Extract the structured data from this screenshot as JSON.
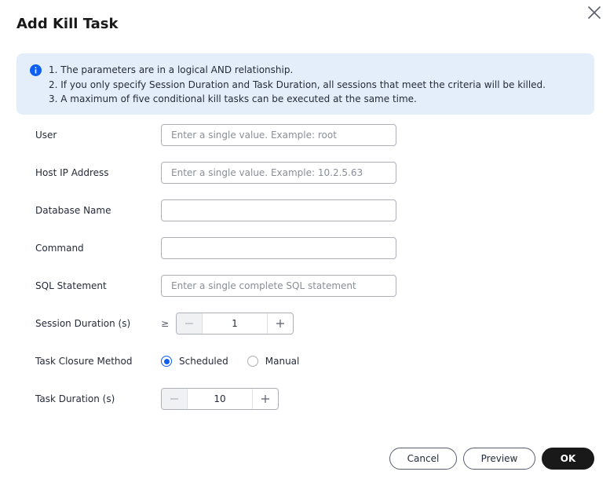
{
  "dialog": {
    "title": "Add Kill Task",
    "close_icon": "close-icon"
  },
  "notice": {
    "icon": "info-icon",
    "accent_color": "#0d5ef2",
    "background_color": "#e4eefb",
    "lines": [
      "1. The parameters are in a logical AND relationship.",
      "2. If you only specify Session Duration and Task Duration, all sessions that meet the criteria will be killed.",
      "3. A maximum of five conditional kill tasks can be executed at the same time."
    ]
  },
  "form": {
    "user": {
      "label": "User",
      "value": "",
      "placeholder": "Enter a single value. Example: root"
    },
    "host_ip": {
      "label": "Host IP Address",
      "value": "",
      "placeholder": "Enter a single value. Example: 10.2.5.63"
    },
    "database_name": {
      "label": "Database Name",
      "value": "",
      "placeholder": ""
    },
    "command": {
      "label": "Command",
      "value": "",
      "placeholder": ""
    },
    "sql_statement": {
      "label": "SQL Statement",
      "value": "",
      "placeholder": "Enter a single complete SQL statement"
    },
    "session_duration": {
      "label": "Session Duration (s)",
      "operator": "≥",
      "value": "1"
    },
    "task_closure_method": {
      "label": "Task Closure Method",
      "options": [
        "Scheduled",
        "Manual"
      ],
      "selected": "Scheduled"
    },
    "task_duration": {
      "label": "Task Duration (s)",
      "value": "10"
    }
  },
  "footer": {
    "cancel_label": "Cancel",
    "preview_label": "Preview",
    "ok_label": "OK"
  }
}
